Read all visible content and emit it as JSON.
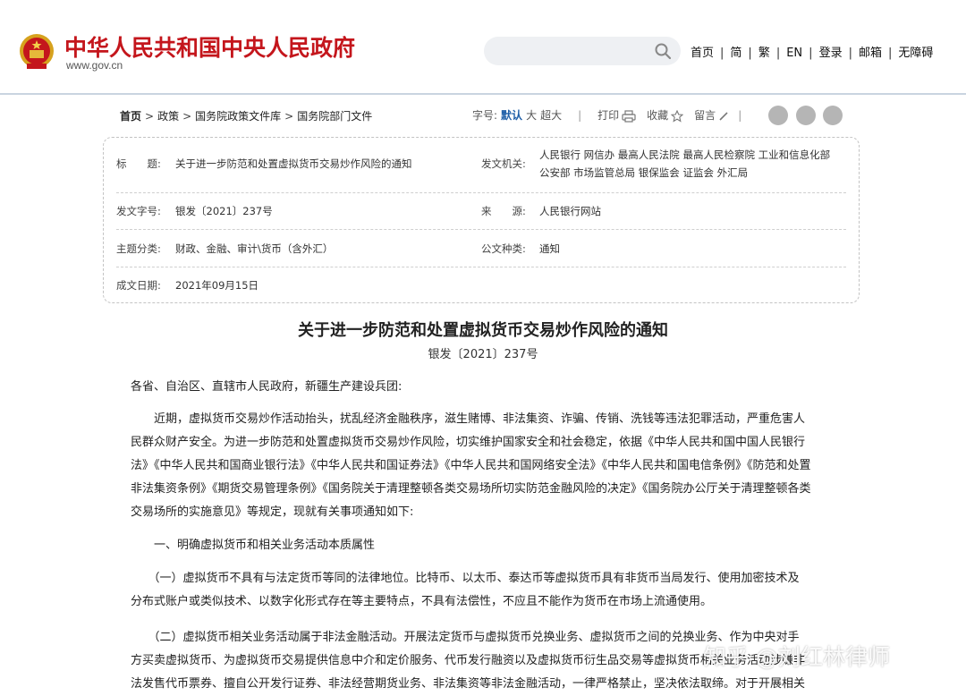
{
  "header": {
    "site_title": "中华人民共和国中央人民政府",
    "site_url": "www.gov.cn",
    "nav": [
      "首页",
      "简",
      "繁",
      "EN",
      "登录",
      "邮箱",
      "无障碍"
    ]
  },
  "breadcrumb": [
    "首页",
    "政策",
    "国务院政策文件库",
    "国务院部门文件"
  ],
  "tools": {
    "font_size_label": "字号:",
    "font_sizes": [
      "默认",
      "大",
      "超大"
    ],
    "print": "打印",
    "favorite": "收藏",
    "comment": "留言"
  },
  "meta": {
    "title_label": "标　　题:",
    "title_value": "关于进一步防范和处置虚拟货币交易炒作风险的通知",
    "issuer_label": "发文机关:",
    "issuer_line1": "人民银行 网信办 最高人民法院 最高人民检察院 工业和信息化部",
    "issuer_line2": "公安部 市场监管总局 银保监会 证监会 外汇局",
    "docno_label": "发文字号:",
    "docno_value": "银发〔2021〕237号",
    "source_label": "来　　源:",
    "source_value": "人民银行网站",
    "topic_label": "主题分类:",
    "topic_value": "财政、金融、审计\\货币（含外汇）",
    "type_label": "公文种类:",
    "type_value": "通知",
    "date_label": "成文日期:",
    "date_value": "2021年09月15日"
  },
  "document": {
    "title": "关于进一步防范和处置虚拟货币交易炒作风险的通知",
    "number": "银发〔2021〕237号",
    "salutation": "各省、自治区、直辖市人民政府，新疆生产建设兵团:",
    "para1": [
      "　　近期，虚拟货币交易炒作活动抬头，扰乱经济金融秩序，滋生赌博、非法集资、诈骗、传销、洗钱等违法犯罪活动，严重危害人",
      "民群众财产安全。为进一步防范和处置虚拟货币交易炒作风险，切实维护国家安全和社会稳定，依据《中华人民共和国中国人民银行",
      "法》《中华人民共和国商业银行法》《中华人民共和国证券法》《中华人民共和国网络安全法》《中华人民共和国电信条例》《防范和处置",
      "非法集资条例》《期货交易管理条例》《国务院关于清理整顿各类交易场所切实防范金融风险的决定》《国务院办公厅关于清理整顿各类",
      "交易场所的实施意见》等规定，现就有关事项通知如下:"
    ],
    "heading1": "　　一、明确虚拟货币和相关业务活动本质属性",
    "para2": [
      "　　（一）虚拟货币不具有与法定货币等同的法律地位。比特币、以太币、泰达币等虚拟货币具有非货币当局发行、使用加密技术及",
      "分布式账户或类似技术、以数字化形式存在等主要特点，不具有法偿性，不应且不能作为货币在市场上流通使用。"
    ],
    "para3": [
      "　　（二）虚拟货币相关业务活动属于非法金融活动。开展法定货币与虚拟货币兑换业务、虚拟货币之间的兑换业务、作为中央对手",
      "方买卖虚拟货币、为虚拟货币交易提供信息中介和定价服务、代币发行融资以及虚拟货币衍生品交易等虚拟货币相关业务活动涉嫌非",
      "法发售代币票券、擅自公开发行证券、非法经营期货业务、非法集资等非法金融活动，一律严格禁止，坚决依法取缔。对于开展相关"
    ]
  },
  "watermark": "知乎 @刘红林律师"
}
